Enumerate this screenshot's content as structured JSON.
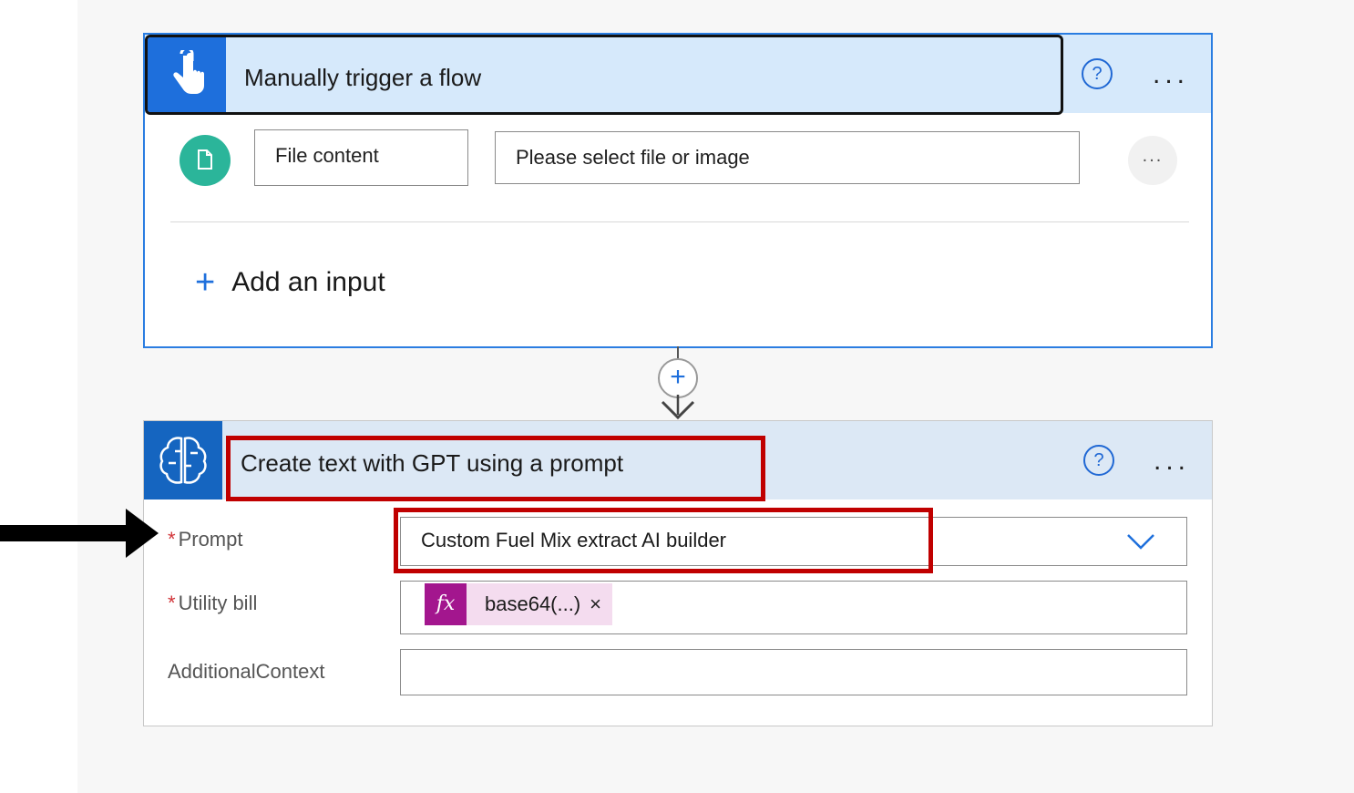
{
  "trigger": {
    "title": "Manually trigger a flow",
    "help_icon": "?",
    "more_icon": "...",
    "input_row": {
      "name_value": "File content",
      "description_value": "Please select file or image",
      "more_icon": "..."
    },
    "add_input_icon": "+",
    "add_input_label": "Add an input"
  },
  "connector": {
    "plus_icon": "+"
  },
  "action": {
    "title": "Create text with GPT using a prompt",
    "help_icon": "?",
    "more_icon": "...",
    "required_marker": "*",
    "prompt": {
      "label": "Prompt",
      "value": "Custom Fuel Mix extract AI builder"
    },
    "utility_bill": {
      "label": "Utility bill",
      "token_icon": "fx",
      "token_text": "base64(...)",
      "remove_icon": "×"
    },
    "additional_context": {
      "label": "AdditionalContext",
      "value": ""
    }
  },
  "colors": {
    "accent_blue": "#1e6fdc",
    "annotation_red": "#c00000",
    "expression_purple": "#a3168e"
  }
}
